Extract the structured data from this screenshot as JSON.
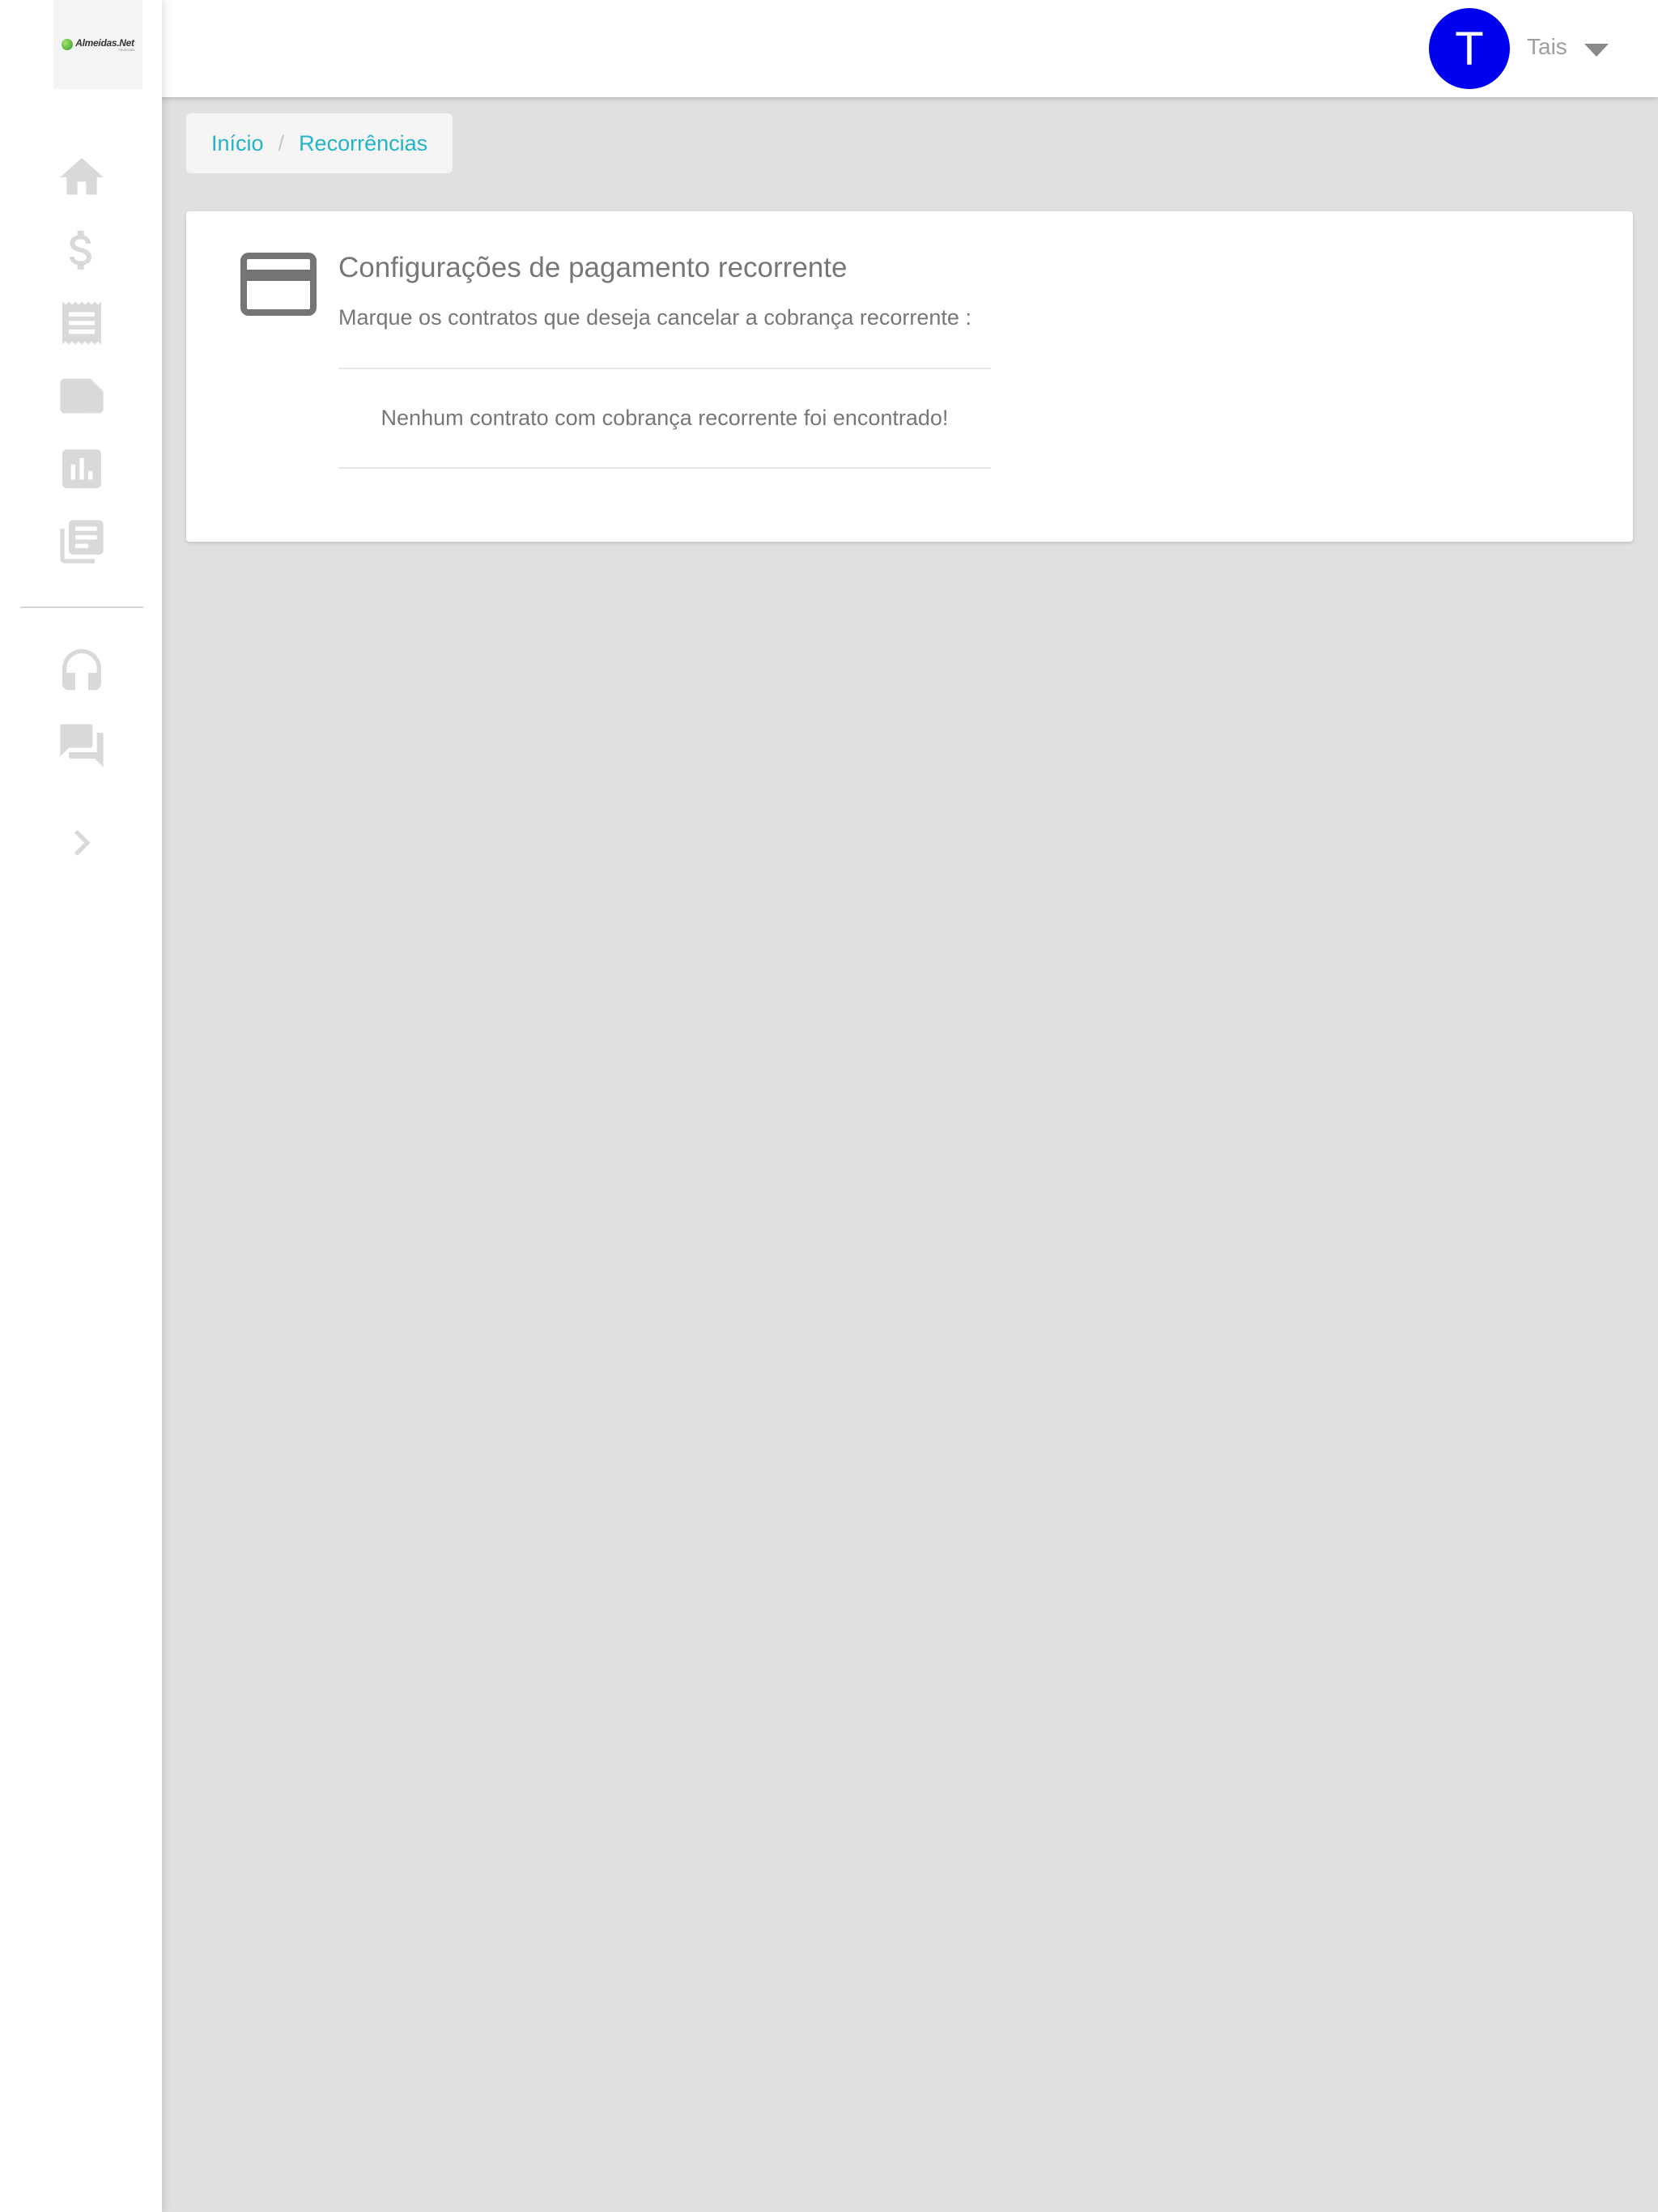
{
  "brand": {
    "logo_text": "Almeidas.Net",
    "logo_subtext": "TELECOM"
  },
  "user": {
    "initial": "T",
    "name": "Tais",
    "avatar_color": "#0000f0"
  },
  "sidebar": {
    "items": [
      {
        "icon": "home-icon"
      },
      {
        "icon": "dollar-icon"
      },
      {
        "icon": "receipt-icon"
      },
      {
        "icon": "note-icon"
      },
      {
        "icon": "bar-chart-icon"
      },
      {
        "icon": "library-books-icon"
      },
      {
        "icon": "headset-icon"
      },
      {
        "icon": "forum-icon"
      },
      {
        "icon": "chevron-right-icon"
      }
    ]
  },
  "breadcrumb": {
    "items": [
      "Início",
      "Recorrências"
    ],
    "separator": "/"
  },
  "card": {
    "icon": "credit-card-icon",
    "title": "Configurações de pagamento recorrente",
    "subtitle": "Marque os contratos que deseja cancelar a cobrança recorrente :",
    "empty_message": "Nenhum contrato com cobrança recorrente foi encontrado!"
  },
  "colors": {
    "accent": "#24b3c9",
    "background": "#e0e0e0",
    "icon_gray": "#d9d9d9",
    "text_gray": "#777777"
  }
}
